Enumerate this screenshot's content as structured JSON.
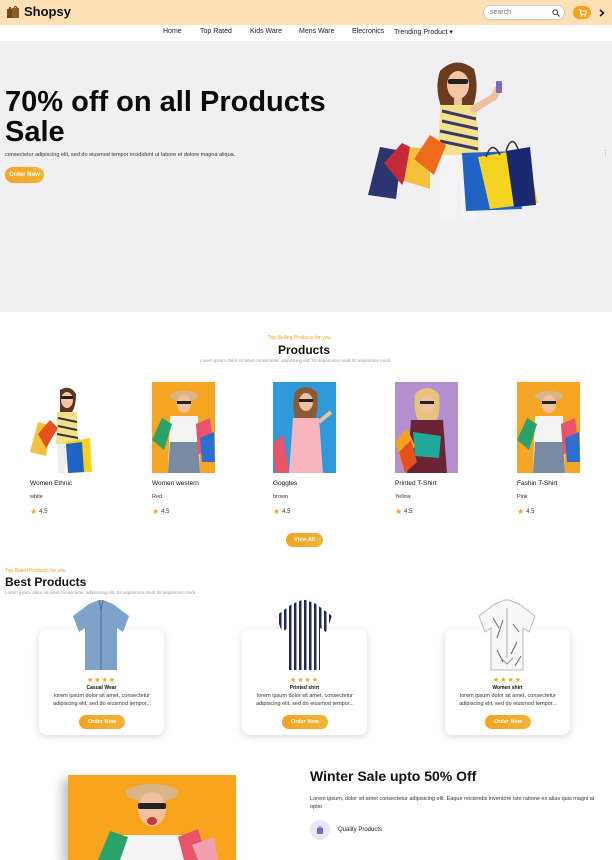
{
  "header": {
    "brand": "Shopsy",
    "search_placeholder": "search"
  },
  "nav": {
    "items": [
      "Home",
      "Top Rated",
      "Kids Ware",
      "Mens Ware",
      "Elecronics",
      "Trending Product"
    ]
  },
  "hero": {
    "title": "70% off on all Products Sale",
    "description": "consectetur adipiscing elit, sed do eiusmod tempor incididunt ut labore et dolore magna aliqua.",
    "button": "Order Now"
  },
  "products": {
    "subtitle": "Top Selling Products for you",
    "title": "Products",
    "description": "Lorem ipsum dolor sit amet consectetur, adipisicing elit. Sit asperiores modi Sit asperiores modi",
    "items": [
      {
        "name": "Women Ethnic",
        "color": "white",
        "rating": "4.5"
      },
      {
        "name": "Women western",
        "color": "Red",
        "rating": "4.5"
      },
      {
        "name": "Goggles",
        "color": "brown",
        "rating": "4.5"
      },
      {
        "name": "Printed T-Shirt",
        "color": "Yellow",
        "rating": "4.5"
      },
      {
        "name": "Fashin T-Shirt",
        "color": "Pink",
        "rating": "4.5"
      }
    ],
    "view_all": "View All"
  },
  "best": {
    "subtitle": "Top Rated Products for you",
    "title": "Best Products",
    "description": "Lorem ipsum dolor sit amet consectetur, adipisicing elit. Sit asperiores modi Sit asperiores modi",
    "items": [
      {
        "name": "Casual Wear",
        "stars": "★★★★",
        "description": "lorem ipsum dolor sit amet, consectetur adipiscing elit, sed do eiusmod tempor...",
        "button": "Order Now"
      },
      {
        "name": "Printed shirt",
        "stars": "★★★★",
        "description": "lorem ipsum dolor sit amet, consectetur adipiscing elit, sed do eiusmod tempor...",
        "button": "Order Now"
      },
      {
        "name": "Women shirt",
        "stars": "★★★★",
        "description": "lorem ipsum dolor sit amet, consectetur adipiscing elit, sed do eiusmod tempor...",
        "button": "Order Now"
      }
    ]
  },
  "banner": {
    "title": "Winter Sale upto 50% Off",
    "description": "Lorem ipsum, dolor sit amet consectetur adipisicing elit. Eaque reiciendis inventore iste ratione ex alias quis magni at optio",
    "feature_label": "Quality Products"
  },
  "colors": {
    "accent": "#f6a21e",
    "topbar": "#fde0b4",
    "hero_bg": "#f0f0f2"
  }
}
